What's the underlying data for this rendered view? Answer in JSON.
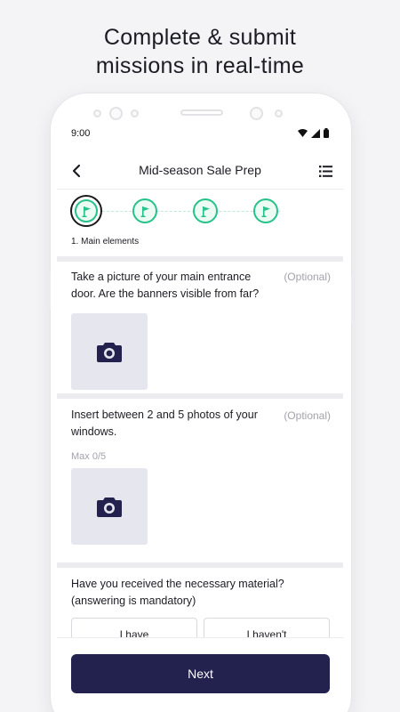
{
  "headline": {
    "line1": "Complete & submit",
    "line2": "missions in real-time"
  },
  "status_bar": {
    "time": "9:00",
    "icons": [
      "wifi-icon",
      "signal-icon",
      "battery-icon"
    ]
  },
  "app_bar": {
    "title": "Mid-season Sale Prep",
    "back_icon": "back-arrow-icon",
    "menu_icon": "list-icon"
  },
  "stepper": {
    "steps": [
      {
        "icon": "flag-icon",
        "active": true
      },
      {
        "icon": "flag-icon",
        "active": false
      },
      {
        "icon": "flag-icon",
        "active": false
      },
      {
        "icon": "flag-icon",
        "active": false
      }
    ],
    "caption": "1. Main elements"
  },
  "questions": [
    {
      "text": "Take a picture of your main entrance door. Are the banners visible from far?",
      "optional_label": "(Optional)",
      "photo_icon": "camera-icon"
    },
    {
      "text": "Insert between 2 and 5 photos of your windows.",
      "optional_label": "(Optional)",
      "hint": "Max 0/5",
      "photo_icon": "camera-icon"
    },
    {
      "text": "Have you received the necessary material? (answering is mandatory)",
      "choices": [
        "I have",
        "I haven't"
      ]
    }
  ],
  "footer": {
    "next_label": "Next"
  },
  "colors": {
    "accent_green": "#27c28a",
    "primary_navy": "#23224e",
    "muted_text": "#a2a2ac",
    "photo_placeholder": "#e6e6ee"
  }
}
